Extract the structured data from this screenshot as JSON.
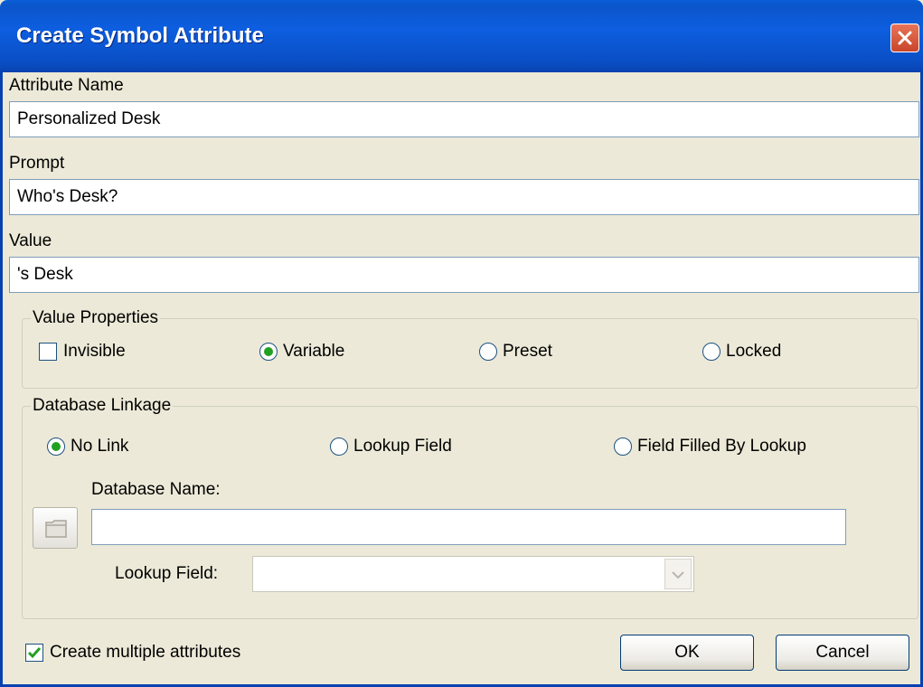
{
  "window": {
    "title": "Create Symbol Attribute"
  },
  "fields": {
    "attribute_name_label": "Attribute Name",
    "attribute_name_value": "Personalized Desk",
    "prompt_label": "Prompt",
    "prompt_value": "Who's Desk?",
    "value_label": "Value",
    "value_value": "'s Desk"
  },
  "value_properties": {
    "legend": "Value Properties",
    "invisible_label": "Invisible",
    "invisible_checked": false,
    "variable_label": "Variable",
    "preset_label": "Preset",
    "locked_label": "Locked",
    "selected": "Variable"
  },
  "database_linkage": {
    "legend": "Database Linkage",
    "no_link_label": "No Link",
    "lookup_field_label": "Lookup Field",
    "field_filled_label": "Field Filled By Lookup",
    "selected": "No Link",
    "database_name_label": "Database Name:",
    "database_name_value": "",
    "lookup_field_combo_label": "Lookup Field:",
    "lookup_field_combo_value": ""
  },
  "footer": {
    "create_multiple_label": "Create multiple attributes",
    "create_multiple_checked": true,
    "ok_label": "OK",
    "cancel_label": "Cancel"
  },
  "colors": {
    "title_bar": "#0a5fd8",
    "dialog_bg": "#ece9d8",
    "radio_dot": "#21a121",
    "check_mark": "#21a121",
    "close_button": "#d9553a"
  }
}
